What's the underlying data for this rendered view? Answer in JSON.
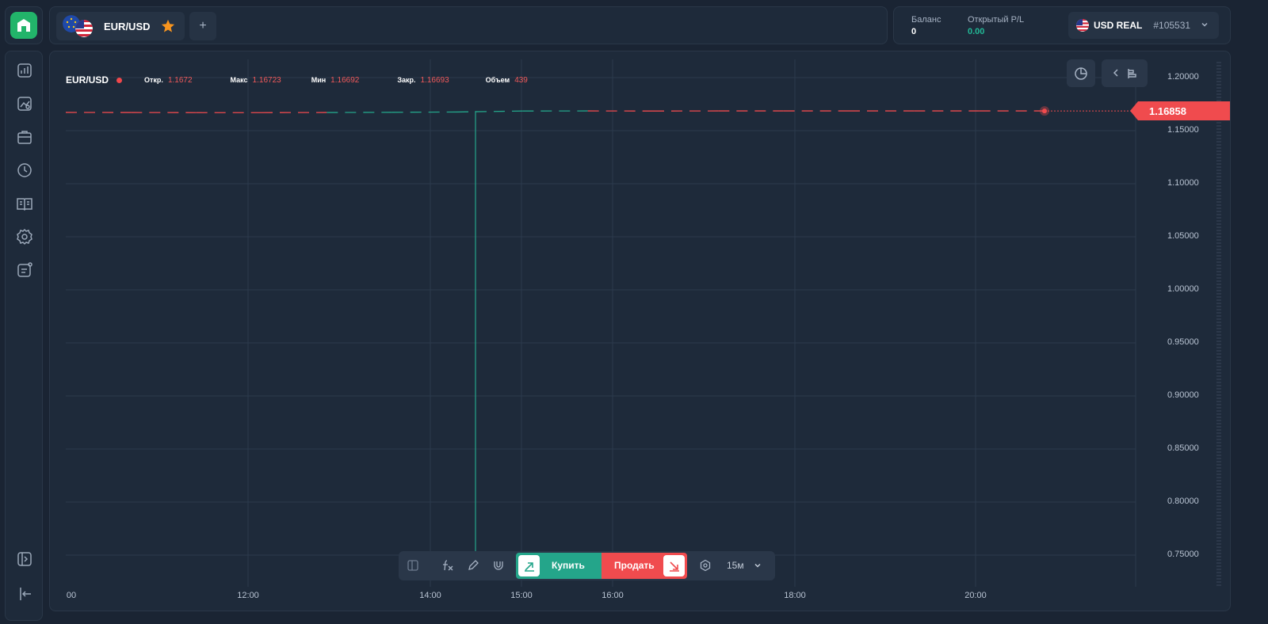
{
  "header": {
    "tab": {
      "symbol": "EUR/USD",
      "favorite": true
    },
    "add_tab_label": "+"
  },
  "account": {
    "balance_label": "Баланс",
    "balance_value": "0",
    "pl_label": "Открытый P/L",
    "pl_value": "0.00",
    "account_name": "USD REAL",
    "account_id": "#105531"
  },
  "sidebar": {
    "items": [
      "chart-icon",
      "picture-chart-icon",
      "briefcase-icon",
      "clock-icon",
      "book-icon",
      "settings-icon",
      "notes-icon"
    ],
    "bottom": [
      "expand-panel-icon",
      "logout-icon"
    ]
  },
  "ohlc": {
    "symbol": "EUR/USD",
    "open_label": "Откр.",
    "open": "1.1672",
    "high_label": "Макс",
    "high": "1.16723",
    "low_label": "Мин",
    "low": "1.16692",
    "close_label": "Закр.",
    "close": "1.16693",
    "volume_label": "Объем",
    "volume": "439"
  },
  "chart_data": {
    "type": "line",
    "title": "",
    "xlabel": "",
    "ylabel": "",
    "y_ticks": [
      "1.20000",
      "1.15000",
      "1.10000",
      "1.05000",
      "1.00000",
      "0.95000",
      "0.90000",
      "0.85000",
      "0.80000",
      "0.75000"
    ],
    "x_ticks": [
      "00",
      "12:00",
      "14:00",
      "15:00",
      "16:00",
      "18:00",
      "20:00"
    ],
    "ylim": [
      0.73,
      1.21
    ],
    "current_price": "1.16858",
    "series": [
      {
        "values": [
          1.1672,
          1.1671,
          1.167,
          1.167,
          1.1671,
          1.1673,
          1.1676,
          1.1685,
          1.1686,
          1.1685,
          1.1686,
          1.1686,
          1.1686,
          1.1686,
          1.1686,
          1.1686
        ]
      }
    ],
    "grid": true
  },
  "toolbar": {
    "buy_label": "Купить",
    "sell_label": "Продать",
    "timeframe": "15м"
  },
  "colors": {
    "up": "#24a58a",
    "down": "#f04b4e",
    "accent": "#22b46a"
  }
}
